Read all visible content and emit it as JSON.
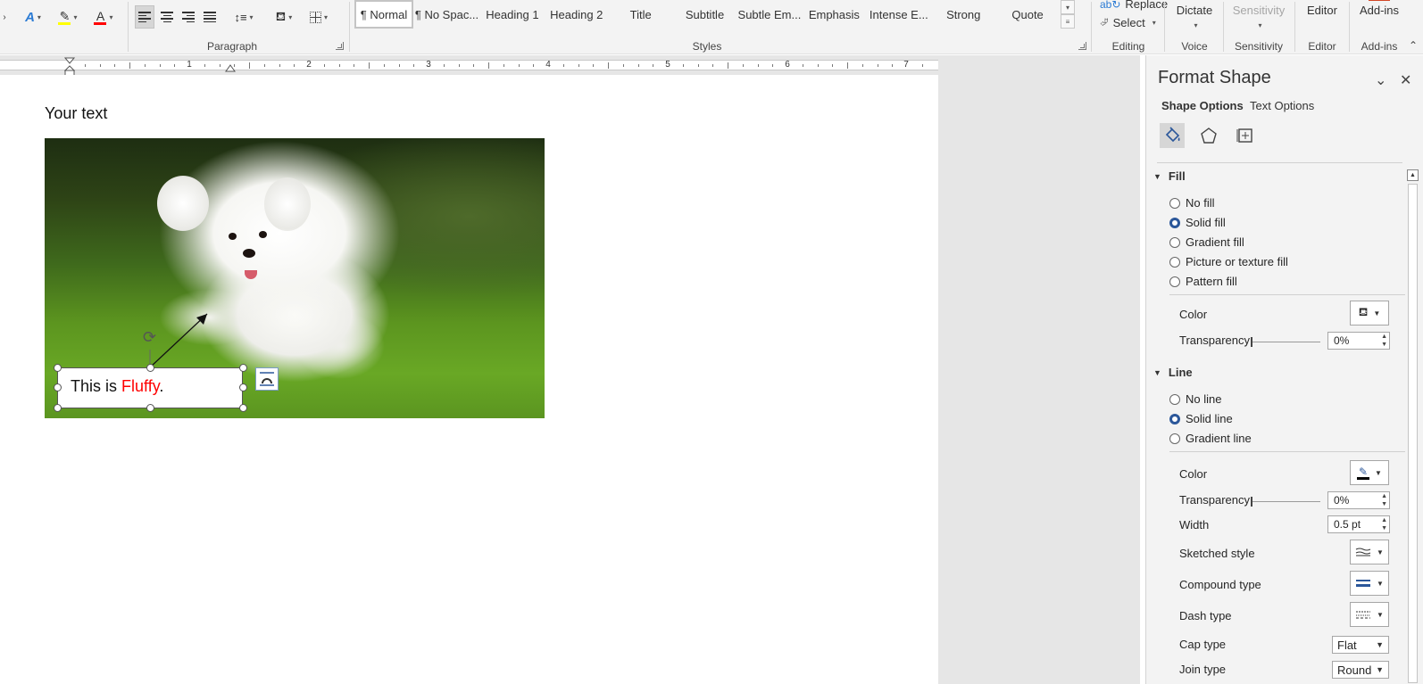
{
  "ribbon": {
    "groups": {
      "paragraph": "Paragraph",
      "styles": "Styles",
      "editing": "Editing",
      "voice": "Voice",
      "sensitivity": "Sensitivity",
      "editor": "Editor",
      "addins": "Add-ins"
    },
    "styles": [
      "¶ Normal",
      "¶ No Spac...",
      "Heading 1",
      "Heading 2",
      "Title",
      "Subtitle",
      "Subtle Em...",
      "Emphasis",
      "Intense E...",
      "Strong",
      "Quote"
    ],
    "editing": {
      "replace": "Replace",
      "select": "Select"
    },
    "buttons": {
      "dictate": "Dictate",
      "sensitivity": "Sensitivity",
      "editor": "Editor",
      "addins": "Add-ins"
    },
    "colors": {
      "highlight": "#ffff00",
      "font_color": "#ff0000",
      "accent": "#2b579a"
    }
  },
  "ruler": {
    "numbers": [
      "1",
      "2",
      "3",
      "4",
      "5",
      "6",
      "7"
    ]
  },
  "document": {
    "heading": "Your text",
    "callout": {
      "prefix": "This is ",
      "highlight": "Fluffy",
      "suffix": "."
    }
  },
  "pane": {
    "title": "Format Shape",
    "tabs": {
      "shape": "Shape Options",
      "text": "Text Options"
    },
    "fill": {
      "header": "Fill",
      "options": [
        "No fill",
        "Solid fill",
        "Gradient fill",
        "Picture or texture fill",
        "Pattern fill"
      ],
      "selected": "Solid fill",
      "color_label": "Color",
      "transparency_label": "Transparency",
      "transparency_value": "0%"
    },
    "line": {
      "header": "Line",
      "options": [
        "No line",
        "Solid line",
        "Gradient line"
      ],
      "selected": "Solid line",
      "color_label": "Color",
      "transparency_label": "Transparency",
      "transparency_value": "0%",
      "width_label": "Width",
      "width_value": "0.5 pt",
      "sketched_label": "Sketched style",
      "compound_label": "Compound type",
      "dash_label": "Dash type",
      "cap_label": "Cap type",
      "cap_value": "Flat",
      "join_label": "Join type",
      "join_value": "Round"
    }
  }
}
